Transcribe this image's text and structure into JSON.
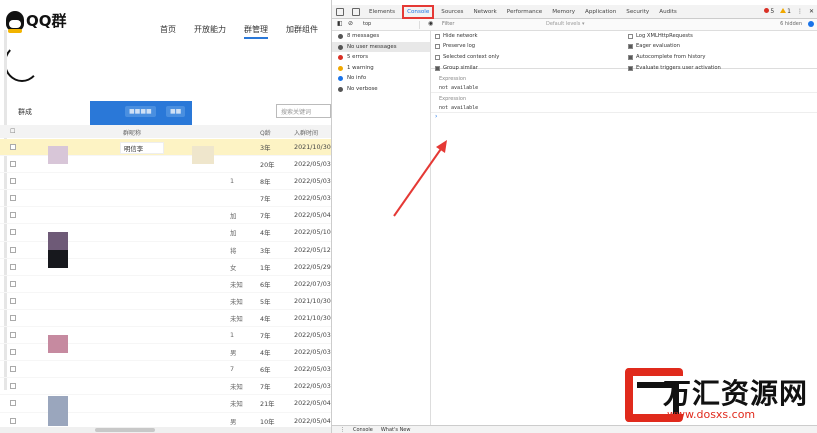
{
  "page": {
    "logo": "QQ群",
    "nav": [
      "首页",
      "开放能力",
      "群管理",
      "加群组件"
    ],
    "active_nav": "群管理",
    "toolbar_label": "群成",
    "search_placeholder": "搜索关键词",
    "headers": [
      "群昵称",
      "Q龄",
      "入群时间"
    ],
    "rows": [
      {
        "name": "明信李",
        "age": "3年",
        "date": "2021/10/30"
      },
      {
        "name": "",
        "age": "20年",
        "date": "2022/05/03"
      },
      {
        "name": "",
        "age": "8年",
        "date": "2022/05/03"
      },
      {
        "name": "",
        "age": "7年",
        "date": "2022/05/03"
      },
      {
        "name": "",
        "age": "7年",
        "date": "2022/05/04"
      },
      {
        "name": "",
        "age": "4年",
        "date": "2022/05/10"
      },
      {
        "name": "",
        "age": "3年",
        "date": "2022/05/12"
      },
      {
        "name": "",
        "age": "1年",
        "date": "2022/05/29"
      },
      {
        "name": "",
        "age": "6年",
        "date": "2022/07/03"
      },
      {
        "name": "",
        "age": "5年",
        "date": "2021/10/30"
      },
      {
        "name": "",
        "age": "4年",
        "date": "2021/10/30"
      },
      {
        "name": "",
        "age": "7年",
        "date": "2022/05/03"
      },
      {
        "name": "",
        "age": "4年",
        "date": "2022/05/03"
      },
      {
        "name": "",
        "age": "6年",
        "date": "2022/05/03"
      },
      {
        "name": "",
        "age": "7年",
        "date": "2022/05/03"
      },
      {
        "name": "",
        "age": "21年",
        "date": "2022/05/04"
      },
      {
        "name": "",
        "age": "10年",
        "date": "2022/05/04"
      }
    ],
    "misc_col": [
      "",
      "",
      "1",
      "",
      "加",
      "加",
      "将",
      "女",
      "未知",
      "未知",
      "未知",
      "1",
      "男",
      "7",
      "未知",
      "未知",
      "男"
    ]
  },
  "devtools": {
    "tabs": [
      "Elements",
      "Console",
      "Sources",
      "Network",
      "Performance",
      "Memory",
      "Application",
      "Security",
      "Audits"
    ],
    "selected_tab": "Console",
    "error_count": "5",
    "warn_count": "1",
    "context": "top",
    "filter_placeholder": "Filter",
    "levels": "Default levels ▾",
    "hidden": "6 hidden",
    "sidebar": [
      {
        "label": "8 messages",
        "color": "#555"
      },
      {
        "label": "No user messages",
        "color": "#555"
      },
      {
        "label": "5 errors",
        "color": "#d93025"
      },
      {
        "label": "1 warning",
        "color": "#f0a800"
      },
      {
        "label": "No info",
        "color": "#1a73e8"
      },
      {
        "label": "No verbose",
        "color": "#555"
      }
    ],
    "settings_left": [
      "Hide network",
      "Preserve log",
      "Selected context only",
      "Group similar"
    ],
    "settings_right": [
      "Log XMLHttpRequests",
      "Eager evaluation",
      "Autocomplete from history",
      "Evaluate triggers user activation"
    ],
    "expressions": [
      {
        "title": "Expression",
        "value": "not available"
      },
      {
        "title": "Expression",
        "value": "not available"
      }
    ],
    "drawer": [
      "Console",
      "What's New"
    ]
  },
  "watermark": {
    "title": "万汇资源网",
    "url": "www.dosxs.com"
  }
}
